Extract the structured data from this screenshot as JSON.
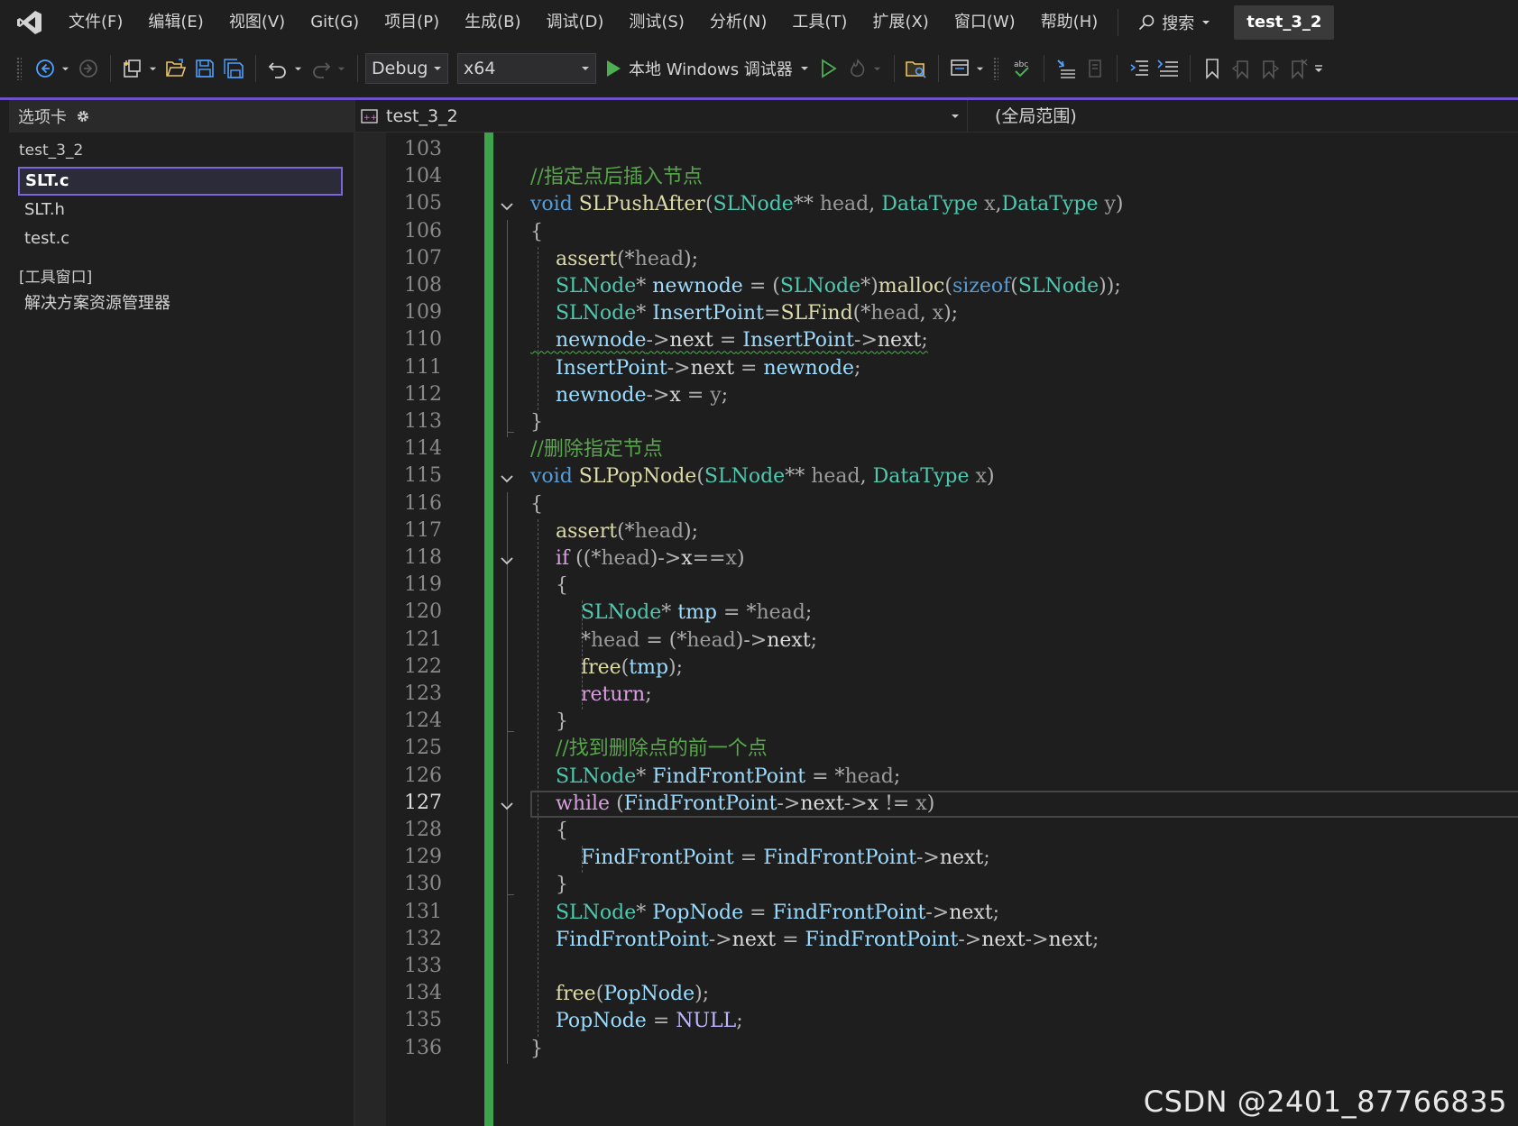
{
  "menubar": {
    "items": [
      "文件(F)",
      "编辑(E)",
      "视图(V)",
      "Git(G)",
      "项目(P)",
      "生成(B)",
      "调试(D)",
      "测试(S)",
      "分析(N)",
      "工具(T)",
      "扩展(X)",
      "窗口(W)",
      "帮助(H)"
    ],
    "search_label": "搜索",
    "solution_name": "test_3_2"
  },
  "toolbar": {
    "configuration": "Debug",
    "platform": "x64",
    "run_label": "本地 Windows 调试器"
  },
  "left_panel": {
    "header": "选项卡",
    "project": "test_3_2",
    "files": [
      "SLT.c",
      "SLT.h",
      "test.c"
    ],
    "selected_file": "SLT.c",
    "tool_windows_group": "[工具窗口]",
    "tool_windows": [
      "解决方案资源管理器"
    ]
  },
  "editor": {
    "nav_file": "test_3_2",
    "nav_scope": "(全局范围)",
    "current_line": 127,
    "line_numbers": [
      "103",
      "104",
      "105",
      "106",
      "107",
      "108",
      "109",
      "110",
      "111",
      "112",
      "113",
      "114",
      "115",
      "116",
      "117",
      "118",
      "119",
      "120",
      "121",
      "122",
      "123",
      "124",
      "125",
      "126",
      "127",
      "128",
      "129",
      "130",
      "131",
      "132",
      "133",
      "134",
      "135",
      "136"
    ],
    "code": [
      "",
      "//指定点后插入节点",
      "void SLPushAfter(SLNode** head, DataType x,DataType y)",
      "{",
      "    assert(*head);",
      "    SLNode* newnode = (SLNode*)malloc(sizeof(SLNode));",
      "    SLNode* InsertPoint=SLFind(*head, x);",
      "    newnode->next = InsertPoint->next;",
      "    InsertPoint->next = newnode;",
      "    newnode->x = y;",
      "}",
      "//删除指定节点",
      "void SLPopNode(SLNode** head, DataType x)",
      "{",
      "    assert(*head);",
      "    if ((*head)->x==x)",
      "    {",
      "        SLNode* tmp = *head;",
      "        *head = (*head)->next;",
      "        free(tmp);",
      "        return;",
      "    }",
      "    //找到删除点的前一个点",
      "    SLNode* FindFrontPoint = *head;",
      "    while (FindFrontPoint->next->x != x)",
      "    {",
      "        FindFrontPoint = FindFrontPoint->next;",
      "    }",
      "    SLNode* PopNode = FindFrontPoint->next;",
      "    FindFrontPoint->next = FindFrontPoint->next->next;",
      "",
      "    free(PopNode);",
      "    PopNode = NULL;",
      "}"
    ]
  },
  "watermark": "CSDN @2401_87766835",
  "colors": {
    "accent": "#6c52c9",
    "change_bar": "#3fa34d",
    "comment": "#57a64a",
    "keyword": "#569cd6",
    "control": "#d8a0df",
    "type": "#4ec9b0",
    "function": "#dcdcaa",
    "variable": "#9cdcfe"
  }
}
